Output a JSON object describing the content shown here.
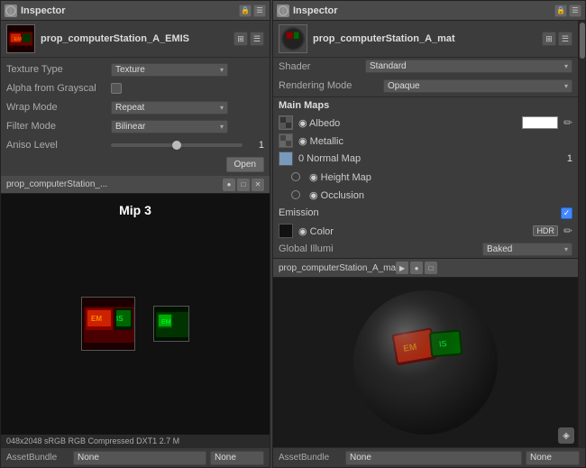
{
  "left_panel": {
    "title": "Inspector",
    "title_icon": "i",
    "asset_name": "prop_computerStation_A_EMIS",
    "texture_type_label": "Texture Type",
    "texture_type_value": "Texture",
    "alpha_label": "Alpha from Grayscal",
    "wrap_mode_label": "Wrap Mode",
    "wrap_mode_value": "Repeat",
    "filter_mode_label": "Filter Mode",
    "filter_mode_value": "Bilinear",
    "aniso_label": "Aniso Level",
    "aniso_value": "1",
    "open_btn": "Open",
    "preview_title": "prop_computerStation_...",
    "mip_label": "Mip 3",
    "status_text": "048x2048 sRGB  RGB Compressed DXT1  2.7 M",
    "assetbundle_label": "AssetBundle",
    "assetbundle_none": "None",
    "assetbundle_none2": "None"
  },
  "right_panel": {
    "title": "Inspector",
    "title_icon": "i",
    "asset_name": "prop_computerStation_A_mat",
    "shader_label": "Shader",
    "shader_value": "Standard",
    "rendering_mode_label": "Rendering Mode",
    "rendering_mode_value": "Opaque",
    "main_maps_label": "Main Maps",
    "albedo_label": "◉ Albedo",
    "metallic_label": "◉ Metallic",
    "normal_map_label": "0 Normal Map",
    "normal_map_value": "1",
    "height_map_label": "◉ Height Map",
    "occlusion_label": "◉ Occlusion",
    "emission_label": "Emission",
    "color_label": "◉ Color",
    "global_illum_label": "Global Illumi",
    "global_illum_value": "Baked",
    "preview_title": "prop_computerStation_A_ma",
    "assetbundle_label": "AssetBundle",
    "assetbundle_none": "None",
    "assetbundle_none2": "None"
  },
  "icons": {
    "lock": "🔒",
    "settings": "⚙",
    "close": "✕",
    "minimize": "─",
    "maximize": "□",
    "play": "▶",
    "check": "✓",
    "pencil": "✏",
    "chevron_down": "▾"
  }
}
